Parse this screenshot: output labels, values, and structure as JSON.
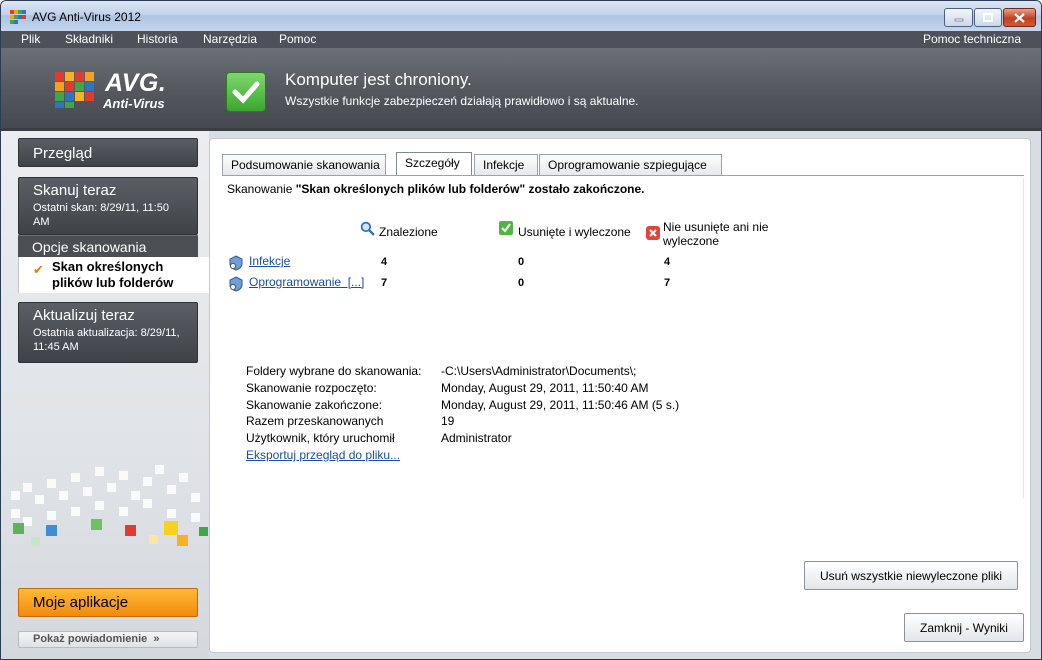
{
  "window": {
    "title": "AVG Anti-Virus 2012",
    "brand_color": "#e37b10"
  },
  "menu": {
    "items": [
      "Plik",
      "Składniki",
      "Historia",
      "Narzędzia",
      "Pomoc"
    ],
    "support": "Pomoc techniczna"
  },
  "header": {
    "logo_main": "AVG.",
    "logo_sub": "Anti-Virus",
    "status_title": "Komputer jest chroniony.",
    "status_subtitle": "Wszystkie funkcje zabezpieczeń działają prawidłowo i są aktualne."
  },
  "sidebar": {
    "overview": "Przegląd",
    "scan_now": "Skanuj teraz",
    "scan_last": "Ostatni skan: 8/29/11, 11:50 AM",
    "scan_options": "Opcje skanowania",
    "selected_item": "Skan określonych plików lub folderów",
    "update_now": "Aktualizuj teraz",
    "update_last": "Ostatnia aktualizacja: 8/29/11, 11:45 AM",
    "my_apps": "Moje aplikacje",
    "show_notification": "Pokaż powiadomienie"
  },
  "tabs": [
    {
      "label": "Podsumowanie skanowania",
      "active": false
    },
    {
      "label": "Szczegóły",
      "active": true
    },
    {
      "label": "Infekcje",
      "active": false
    },
    {
      "label": "Oprogramowanie szpiegujące",
      "active": false
    }
  ],
  "scan": {
    "prefix": "Skanowanie ",
    "name": "\"Skan określonych plików lub folderów\" zostało zakończone."
  },
  "results": {
    "columns": {
      "found": "Znalezione",
      "removed": "Usunięte i wyleczone",
      "not_removed": "Nie usunięte ani nie wyleczone"
    },
    "rows": [
      {
        "label": "Infekcje",
        "found": "4",
        "removed": "0",
        "not_removed": "4"
      },
      {
        "label": "Oprogramowanie  [...]",
        "found": "7",
        "removed": "0",
        "not_removed": "7"
      }
    ]
  },
  "details": {
    "folders_label": "Foldery wybrane do skanowania:",
    "folders_value": "-C:\\Users\\Administrator\\Documents\\;",
    "started_label": "Skanowanie rozpoczęto:",
    "started_value": "Monday, August 29, 2011, 11:50:40 AM",
    "finished_label": "Skanowanie zakończone:",
    "finished_value": "Monday, August 29, 2011, 11:50:46 AM (5 s.)",
    "total_label": "Razem przeskanowanych",
    "total_value": "19",
    "user_label": "Użytkownik, który uruchomił",
    "user_value": "Administrator",
    "export_link": "Eksportuj przegląd do pliku..."
  },
  "buttons": {
    "remove_all": "Usuń wszystkie niewyleczone pliki",
    "close_results": "Zamknij - Wyniki"
  }
}
